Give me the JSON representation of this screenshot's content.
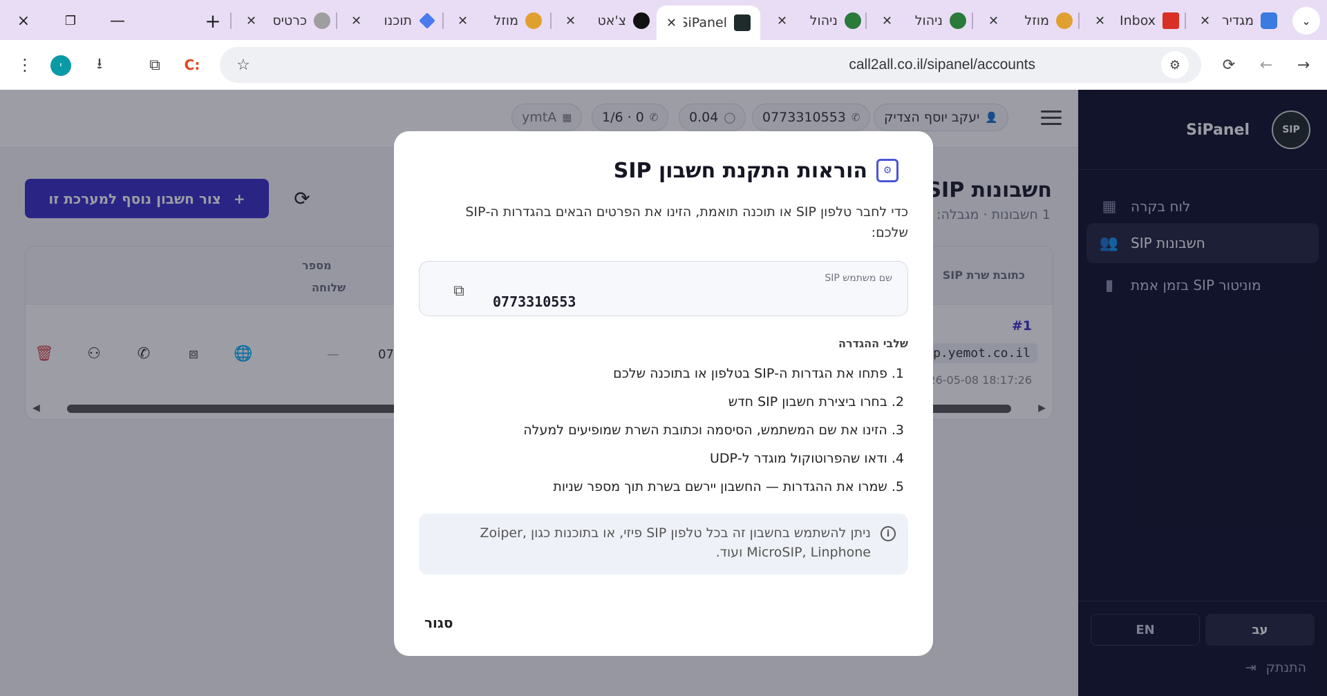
{
  "browser": {
    "tabs": [
      {
        "title": "מגדיר",
        "favicon_color": "#3a7be0"
      },
      {
        "title": "Inbox",
        "favicon_color": "#d93025"
      },
      {
        "title": "מוזל",
        "favicon_color": "#e0a030"
      },
      {
        "title": "ניהול",
        "favicon_color": "#2a7a3a"
      },
      {
        "title": "ניהול",
        "favicon_color": "#2a7a3a"
      },
      {
        "title": "SiPanel",
        "favicon_color": "#1f2a2a"
      },
      {
        "title": "צ'אט",
        "favicon_color": "#111111"
      },
      {
        "title": "מוזל",
        "favicon_color": "#e0a030"
      },
      {
        "title": "תוכנו",
        "favicon_color": "#4a7bf0"
      },
      {
        "title": "כרטיס",
        "favicon_color": "#555555"
      }
    ],
    "url": "call2all.co.il/sipanel/accounts",
    "profile_initial": "י",
    "icons": {
      "close_window": "×",
      "restore": "❐",
      "minimize": "—",
      "new_tab": "+",
      "back": "←",
      "forward": "→",
      "reload": "⟳",
      "star": "☆",
      "menu": "⋮",
      "download": "⭳",
      "extension": "⧉",
      "ext_letter": "C:",
      "site_settings": "⚙",
      "dropdown": "⌄"
    }
  },
  "header": {
    "chips": [
      {
        "label": "יעקב יוסף הצדיק",
        "icon": "👤"
      },
      {
        "label": "0773310553",
        "icon": "✆"
      },
      {
        "label": "0.04",
        "icon": "◯"
      },
      {
        "label": "1/6 · 0",
        "icon": "✆"
      },
      {
        "label": "ymtA",
        "icon": "▦"
      }
    ]
  },
  "main": {
    "title": "חשבונות SIP",
    "subtitle": "1 חשבונות · מגבלה: 6",
    "add_button": "צור חשבון נוסף למערכת זו",
    "add_icon": "+",
    "refresh_icon": "⟳",
    "table": {
      "headers": {
        "server": "כתובת שרת SIP",
        "number_line1": "מספר",
        "number_line2": "שלוחה"
      },
      "row": {
        "index": "#1",
        "server": "sip.yemot.co.il",
        "date": "2026-05-08 18:17:26",
        "number": "07",
        "dash": "—"
      },
      "row_icons": [
        "🌐",
        "⧈",
        "✆",
        "⚇",
        "🗑"
      ]
    }
  },
  "sidebar": {
    "brand": "SiPanel",
    "logo_text": "SIP",
    "nav": [
      {
        "label": "לוח בקרה",
        "icon": "▦"
      },
      {
        "label": "חשבונות SIP",
        "icon": "👥"
      },
      {
        "label": "מוניטור SIP בזמן אמת",
        "icon": "▮"
      }
    ],
    "lang": {
      "he": "עב",
      "en": "EN"
    },
    "logout": "התנתק",
    "logout_icon": "⇥"
  },
  "modal": {
    "title": "הוראות התקנת חשבון SIP",
    "intro": "כדי לחבר טלפון SIP או תוכנה תואמת, הזינו את הפרטים הבאים בהגדרות ה-SIP שלכם:",
    "username_label": "שם משתמש SIP",
    "username_value": "0773310553",
    "steps_title": "שלבי ההגדרה",
    "steps": [
      "1. פתחו את הגדרות ה-SIP בטלפון או בתוכנה שלכם",
      "2. בחרו ביצירת חשבון SIP חדש",
      "3. הזינו את שם המשתמש, הסיסמה וכתובת השרת שמופיעים למעלה",
      "4. ודאו שהפרוטוקול מוגדר ל-UDP",
      "5. שמרו את ההגדרות — החשבון יירשם בשרת תוך מספר שניות"
    ],
    "info": "ניתן להשתמש בחשבון זה בכל טלפון SIP פיזי, או בתוכנות כגון Zoiper, MicroSIP, Linphone ועוד.",
    "close": "סגור",
    "copy_icon": "⧉",
    "info_icon": "i",
    "title_icon": "⚙"
  }
}
